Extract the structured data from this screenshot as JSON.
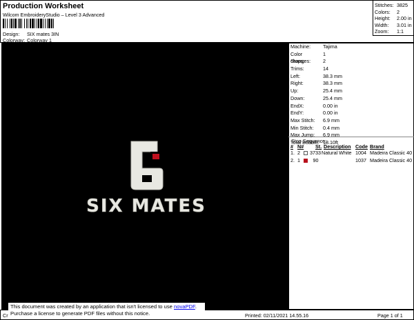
{
  "header": {
    "title": "Production Worksheet",
    "subtitle": "Wilcom EmbroideryStudio – Level 3 Advanced",
    "design_label": "Design:",
    "design_value": "SIX mates 3IN",
    "colorway_label": "Colorway:",
    "colorway_value": "Colorway 1"
  },
  "summary": [
    {
      "label": "Stitches:",
      "value": "3825"
    },
    {
      "label": "Colors:",
      "value": "2"
    },
    {
      "label": "Height:",
      "value": "2.00 in"
    },
    {
      "label": "Width:",
      "value": "3.01 in"
    },
    {
      "label": "Zoom:",
      "value": "1:1"
    }
  ],
  "design_preview": {
    "icon": "six-mates-logo",
    "numeral": "6",
    "text": "SIX MATES",
    "colors": {
      "background": "#000000",
      "thread": "#e8e8e2",
      "accent": "#c0101e"
    }
  },
  "machine_info": [
    {
      "label": "Machine:",
      "value": "Tajima"
    },
    {
      "label": "Color changes:",
      "value": "1"
    },
    {
      "label": "Stops:",
      "value": "2"
    },
    {
      "label": "Trims:",
      "value": "14"
    },
    {
      "label": "Left:",
      "value": "38.3 mm"
    },
    {
      "label": "Right:",
      "value": "38.3 mm"
    },
    {
      "label": "Up:",
      "value": "25.4 mm"
    },
    {
      "label": "Down:",
      "value": "25.4 mm"
    },
    {
      "label": "EndX:",
      "value": "0.00 in"
    },
    {
      "label": "EndY:",
      "value": "0.00 in"
    },
    {
      "label": "Max Stitch:",
      "value": "6.9 mm"
    },
    {
      "label": "Min Stitch:",
      "value": "0.4 mm"
    },
    {
      "label": "Max Jump:",
      "value": "6.9 mm"
    },
    {
      "label": "Total Bobbin:",
      "value": "18.10ft"
    }
  ],
  "stop_sequence": {
    "title": "Stop Sequence:",
    "headers": {
      "num": "#",
      "n": "N#",
      "st": "St.",
      "description": "Description",
      "code": "Code",
      "brand": "Brand"
    },
    "rows": [
      {
        "num": "1.",
        "n": "2",
        "swatch": "#ffffff",
        "st": "3733",
        "description": "Natural White",
        "code": "1004",
        "brand": "Madeira Classic 40"
      },
      {
        "num": "2.",
        "n": "1",
        "swatch": "#b80f1c",
        "st": "90",
        "description": "",
        "code": "1037",
        "brand": "Madeira Classic 40"
      }
    ]
  },
  "footer": {
    "left_fragment": "Cr",
    "printed": "Printed: 02/11/2021 14.55.16",
    "page": "Page 1 of 1",
    "notice_line1": "This document was created by an application that isn't licensed to use ",
    "notice_link": "novaPDF",
    "notice_line1_end": ".",
    "notice_line2": "Purchase a license to generate PDF files without this notice."
  }
}
